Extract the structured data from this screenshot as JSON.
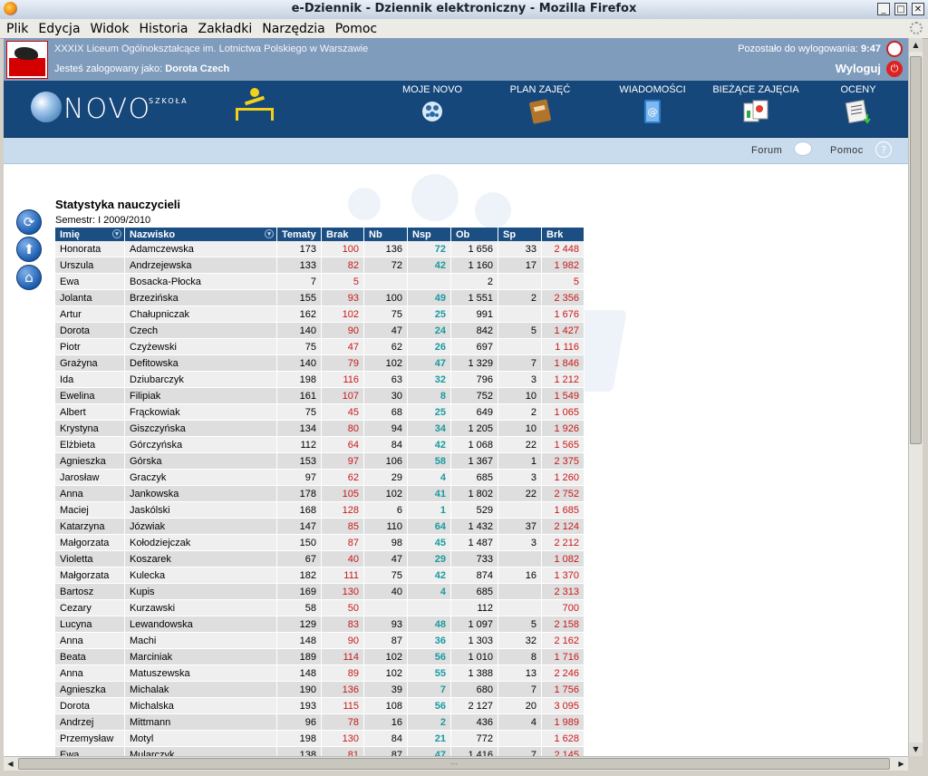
{
  "window": {
    "title": "e-Dziennik - Dziennik elektroniczny - Mozilla Firefox",
    "min": "_",
    "max": "□",
    "close": "✕"
  },
  "menu": [
    "Plik",
    "Edycja",
    "Widok",
    "Historia",
    "Zakładki",
    "Narzędzia",
    "Pomoc"
  ],
  "header": {
    "school": "XXXIX Liceum Ogólnokształcące im. Lotnictwa Polskiego w Warszawie",
    "logged_prefix": "Jesteś zalogowany jako:",
    "user": "Dorota Czech",
    "remaining_label": "Pozostało do wylogowania:",
    "remaining_time": "9:47",
    "logout": "Wyloguj"
  },
  "brand": {
    "word": "NOVO",
    "small": "SZKOŁA"
  },
  "nav": [
    {
      "label": "MOJE NOVO",
      "icon": "globe-icon"
    },
    {
      "label": "PLAN ZAJĘĆ",
      "icon": "notebook-icon"
    },
    {
      "label": "WIADOMOŚCI",
      "icon": "mail-book-icon"
    },
    {
      "label": "BIEŻĄCE ZAJĘCIA",
      "icon": "documents-icon"
    },
    {
      "label": "OCENY",
      "icon": "grades-icon"
    }
  ],
  "subbar": {
    "forum": "Forum",
    "help": "Pomoc",
    "help_glyph": "?"
  },
  "page": {
    "title": "Statystyka nauczycieli",
    "semester": "Semestr: I 2009/2010"
  },
  "table": {
    "columns": [
      "Imię",
      "Nazwisko",
      "Tematy",
      "Brak",
      "Nb",
      "Nsp",
      "Ob",
      "Sp",
      "Brk"
    ],
    "rows": [
      [
        "Honorata",
        "Adamczewska",
        "173",
        "100",
        "136",
        "72",
        "1 656",
        "33",
        "2 448"
      ],
      [
        "Urszula",
        "Andrzejewska",
        "133",
        "82",
        "72",
        "42",
        "1 160",
        "17",
        "1 982"
      ],
      [
        "Ewa",
        "Bosacka-Płocka",
        "7",
        "5",
        "",
        "",
        "2",
        "",
        "5"
      ],
      [
        "Jolanta",
        "Brzezińska",
        "155",
        "93",
        "100",
        "49",
        "1 551",
        "2",
        "2 356"
      ],
      [
        "Artur",
        "Chałupniczak",
        "162",
        "102",
        "75",
        "25",
        "991",
        "",
        "1 676"
      ],
      [
        "Dorota",
        "Czech",
        "140",
        "90",
        "47",
        "24",
        "842",
        "5",
        "1 427"
      ],
      [
        "Piotr",
        "Czyżewski",
        "75",
        "47",
        "62",
        "26",
        "697",
        "",
        "1 116"
      ],
      [
        "Grażyna",
        "Defitowska",
        "140",
        "79",
        "102",
        "47",
        "1 329",
        "7",
        "1 846"
      ],
      [
        "Ida",
        "Dziubarczyk",
        "198",
        "116",
        "63",
        "32",
        "796",
        "3",
        "1 212"
      ],
      [
        "Ewelina",
        "Filipiak",
        "161",
        "107",
        "30",
        "8",
        "752",
        "10",
        "1 549"
      ],
      [
        "Albert",
        "Frąckowiak",
        "75",
        "45",
        "68",
        "25",
        "649",
        "2",
        "1 065"
      ],
      [
        "Krystyna",
        "Giszczyńska",
        "134",
        "80",
        "94",
        "34",
        "1 205",
        "10",
        "1 926"
      ],
      [
        "Elżbieta",
        "Górczyńska",
        "112",
        "64",
        "84",
        "42",
        "1 068",
        "22",
        "1 565"
      ],
      [
        "Agnieszka",
        "Górska",
        "153",
        "97",
        "106",
        "58",
        "1 367",
        "1",
        "2 375"
      ],
      [
        "Jarosław",
        "Graczyk",
        "97",
        "62",
        "29",
        "4",
        "685",
        "3",
        "1 260"
      ],
      [
        "Anna",
        "Jankowska",
        "178",
        "105",
        "102",
        "41",
        "1 802",
        "22",
        "2 752"
      ],
      [
        "Maciej",
        "Jaskólski",
        "168",
        "128",
        "6",
        "1",
        "529",
        "",
        "1 685"
      ],
      [
        "Katarzyna",
        "Józwiak",
        "147",
        "85",
        "110",
        "64",
        "1 432",
        "37",
        "2 124"
      ],
      [
        "Małgorzata",
        "Kołodziejczak",
        "150",
        "87",
        "98",
        "45",
        "1 487",
        "3",
        "2 212"
      ],
      [
        "Violetta",
        "Koszarek",
        "67",
        "40",
        "47",
        "29",
        "733",
        "",
        "1 082"
      ],
      [
        "Małgorzata",
        "Kulecka",
        "182",
        "111",
        "75",
        "42",
        "874",
        "16",
        "1 370"
      ],
      [
        "Bartosz",
        "Kupis",
        "169",
        "130",
        "40",
        "4",
        "685",
        "",
        "2 313"
      ],
      [
        "Cezary",
        "Kurzawski",
        "58",
        "50",
        "",
        "",
        "112",
        "",
        "700"
      ],
      [
        "Lucyna",
        "Lewandowska",
        "129",
        "83",
        "93",
        "48",
        "1 097",
        "5",
        "2 158"
      ],
      [
        "Anna",
        "Machi",
        "148",
        "90",
        "87",
        "36",
        "1 303",
        "32",
        "2 162"
      ],
      [
        "Beata",
        "Marciniak",
        "189",
        "114",
        "102",
        "56",
        "1 010",
        "8",
        "1 716"
      ],
      [
        "Anna",
        "Matuszewska",
        "148",
        "89",
        "102",
        "55",
        "1 388",
        "13",
        "2 246"
      ],
      [
        "Agnieszka",
        "Michalak",
        "190",
        "136",
        "39",
        "7",
        "680",
        "7",
        "1 756"
      ],
      [
        "Dorota",
        "Michalska",
        "193",
        "115",
        "108",
        "56",
        "2 127",
        "20",
        "3 095"
      ],
      [
        "Andrzej",
        "Mittmann",
        "96",
        "78",
        "16",
        "2",
        "436",
        "4",
        "1 989"
      ],
      [
        "Przemysław",
        "Motyl",
        "198",
        "130",
        "84",
        "21",
        "772",
        "",
        "1 628"
      ],
      [
        "Ewa",
        "Mularczyk",
        "138",
        "81",
        "87",
        "47",
        "1 416",
        "7",
        "2 145"
      ]
    ]
  },
  "colors": {
    "header_bg": "#7f9cbc",
    "nav_bg": "#15477a",
    "subbar_bg": "#c9dced",
    "th_bg": "#1b4f83",
    "red": "#c8191b",
    "teal": "#1a9aa0"
  }
}
